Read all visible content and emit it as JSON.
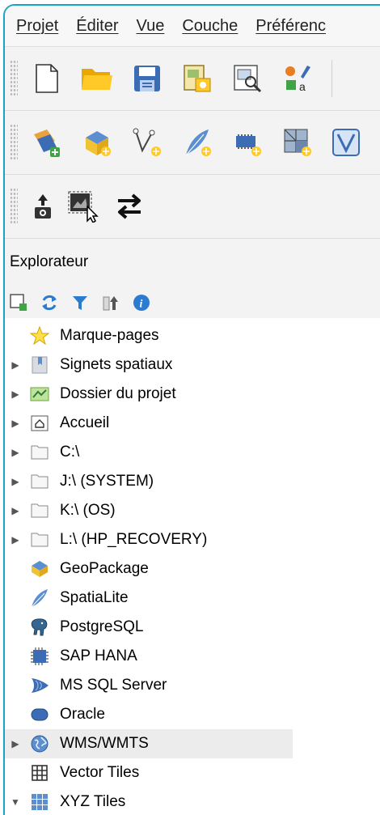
{
  "menubar": {
    "items": [
      "Projet",
      "Éditer",
      "Vue",
      "Couche",
      "Préférenc"
    ]
  },
  "panel": {
    "title": "Explorateur"
  },
  "tree": {
    "items": [
      {
        "label": "Marque-pages",
        "icon": "star-icon"
      },
      {
        "label": "Signets spatiaux",
        "icon": "bookmark-icon"
      },
      {
        "label": "Dossier du projet",
        "icon": "project-folder-icon"
      },
      {
        "label": "Accueil",
        "icon": "home-folder-icon"
      },
      {
        "label": "C:\\",
        "icon": "drive-folder-icon"
      },
      {
        "label": "J:\\ (SYSTEM)",
        "icon": "drive-folder-icon"
      },
      {
        "label": "K:\\ (OS)",
        "icon": "drive-folder-icon"
      },
      {
        "label": "L:\\ (HP_RECOVERY)",
        "icon": "drive-folder-icon"
      },
      {
        "label": "GeoPackage",
        "icon": "geopackage-icon"
      },
      {
        "label": "SpatiaLite",
        "icon": "feather-icon"
      },
      {
        "label": "PostgreSQL",
        "icon": "elephant-icon"
      },
      {
        "label": "SAP HANA",
        "icon": "hana-icon"
      },
      {
        "label": "MS SQL Server",
        "icon": "mssql-icon"
      },
      {
        "label": "Oracle",
        "icon": "oracle-icon"
      },
      {
        "label": "WMS/WMTS",
        "icon": "globe-icon"
      },
      {
        "label": "Vector Tiles",
        "icon": "vector-tiles-icon"
      },
      {
        "label": "XYZ Tiles",
        "icon": "xyz-tiles-icon"
      }
    ]
  }
}
